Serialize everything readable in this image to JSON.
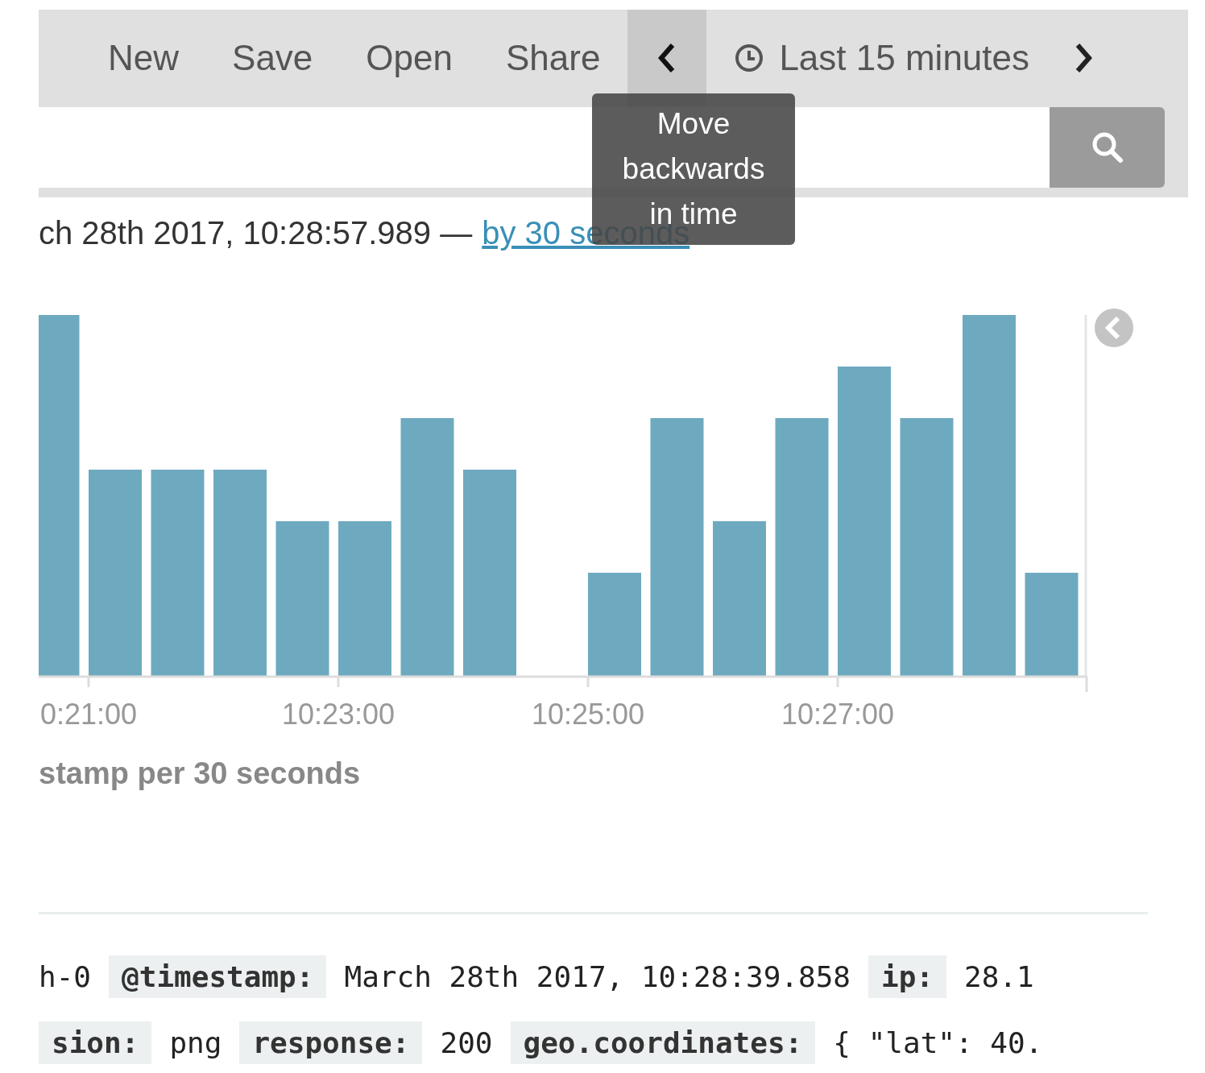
{
  "toolbar": {
    "menu": [
      {
        "label": "New"
      },
      {
        "label": "Save"
      },
      {
        "label": "Open"
      },
      {
        "label": "Share"
      }
    ],
    "time_range": "Last 15 minutes"
  },
  "tooltip": "Move backwards in time",
  "range": {
    "text": "ch 28th 2017, 10:28:57.989 —",
    "interval_link": "by 30 seconds"
  },
  "chart": {
    "x_ticks": [
      "0:21:00",
      "10:23:00",
      "10:25:00",
      "10:27:00"
    ],
    "axis_title": "stamp per 30 seconds"
  },
  "document": [
    [
      {
        "kind": "value",
        "text": "h-0"
      },
      {
        "kind": "key",
        "text": "@timestamp:"
      },
      {
        "kind": "value",
        "text": "March 28th 2017, 10:28:39.858"
      },
      {
        "kind": "key",
        "text": "ip:"
      },
      {
        "kind": "value",
        "text": "28.1"
      }
    ],
    [
      {
        "kind": "key",
        "text": "sion:"
      },
      {
        "kind": "value",
        "text": "png"
      },
      {
        "kind": "key",
        "text": "response:"
      },
      {
        "kind": "value",
        "text": "200"
      },
      {
        "kind": "key",
        "text": "geo.coordinates:"
      },
      {
        "kind": "value",
        "text": "{ \"lat\": 40."
      }
    ]
  ]
}
